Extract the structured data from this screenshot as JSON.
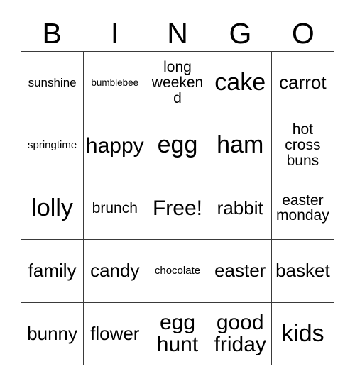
{
  "card": {
    "type": "bingo-card",
    "theme": "easter",
    "columns": 5,
    "rows": 5,
    "colors": {
      "background": "#ffffff",
      "text": "#000000",
      "border": "#3a3a3a"
    }
  },
  "header": {
    "letters": [
      "B",
      "I",
      "N",
      "G",
      "O"
    ]
  },
  "grid": {
    "rows": [
      {
        "cells": [
          {
            "text": "sunshine",
            "size": "sm"
          },
          {
            "text": "bumblebee",
            "size": "xxs"
          },
          {
            "text": "long\nweekend",
            "size": "md"
          },
          {
            "text": "cake",
            "size": "xxl"
          },
          {
            "text": "carrot",
            "size": "lg"
          }
        ]
      },
      {
        "cells": [
          {
            "text": "springtime",
            "size": "xs"
          },
          {
            "text": "happy",
            "size": "xl"
          },
          {
            "text": "egg",
            "size": "xxl"
          },
          {
            "text": "ham",
            "size": "xxl"
          },
          {
            "text": "hot\ncross\nbuns",
            "size": "md"
          }
        ]
      },
      {
        "cells": [
          {
            "text": "lolly",
            "size": "xxl"
          },
          {
            "text": "brunch",
            "size": "md"
          },
          {
            "text": "Free!",
            "size": "xl"
          },
          {
            "text": "rabbit",
            "size": "lg"
          },
          {
            "text": "easter\nmonday",
            "size": "md"
          }
        ]
      },
      {
        "cells": [
          {
            "text": "family",
            "size": "lg"
          },
          {
            "text": "candy",
            "size": "lg"
          },
          {
            "text": "chocolate",
            "size": "xs"
          },
          {
            "text": "easter",
            "size": "lg"
          },
          {
            "text": "basket",
            "size": "lg"
          }
        ]
      },
      {
        "cells": [
          {
            "text": "bunny",
            "size": "lg"
          },
          {
            "text": "flower",
            "size": "lg"
          },
          {
            "text": "egg\nhunt",
            "size": "xl"
          },
          {
            "text": "good\nfriday",
            "size": "xl"
          },
          {
            "text": "kids",
            "size": "xxl"
          }
        ]
      }
    ]
  }
}
